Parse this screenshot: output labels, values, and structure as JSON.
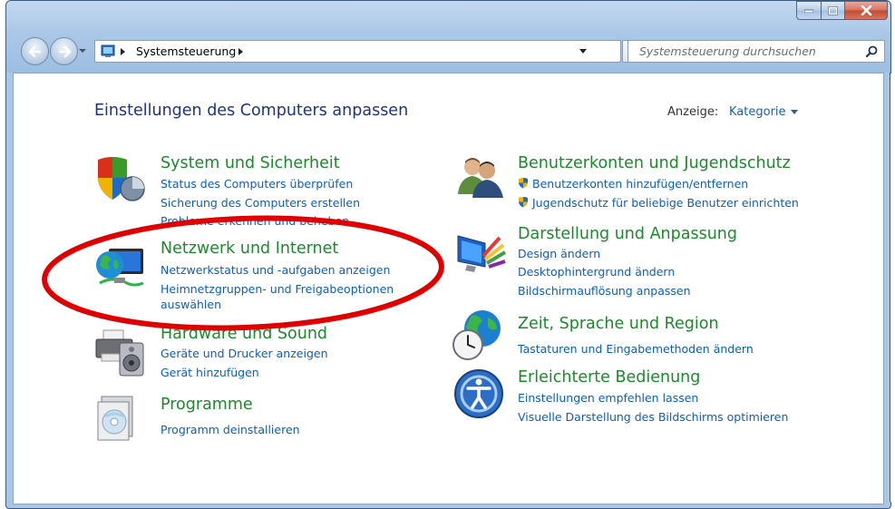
{
  "window": {
    "breadcrumb_root": "Systemsteuerung"
  },
  "search": {
    "placeholder": "Systemsteuerung durchsuchen"
  },
  "header": {
    "title": "Einstellungen des Computers anpassen",
    "view_label": "Anzeige:",
    "view_value": "Kategorie"
  },
  "categories": [
    {
      "title": "System und Sicherheit",
      "icon": "shield-icon",
      "links": [
        "Status des Computers überprüfen",
        "Sicherung des Computers erstellen",
        "Probleme erkennen und beheben"
      ]
    },
    {
      "title": "Netzwerk und Internet",
      "icon": "network-globe-icon",
      "links": [
        "Netzwerkstatus und -aufgaben anzeigen",
        "Heimnetzgruppen- und Freigabeoptionen",
        "auswählen"
      ]
    },
    {
      "title": "Hardware und Sound",
      "icon": "printer-speaker-icon",
      "links": [
        "Geräte und Drucker anzeigen",
        "Gerät hinzufügen"
      ]
    },
    {
      "title": "Programme",
      "icon": "programs-icon",
      "links": [
        "Programm deinstallieren"
      ]
    },
    {
      "title": "Benutzerkonten und Jugendschutz",
      "icon": "users-icon",
      "links": [
        "Benutzerkonten hinzufügen/entfernen",
        "Jugendschutz für beliebige Benutzer einrichten"
      ]
    },
    {
      "title": "Darstellung und Anpassung",
      "icon": "appearance-icon",
      "links": [
        "Design ändern",
        "Desktophintergrund ändern",
        "Bildschirmauflösung anpassen"
      ]
    },
    {
      "title": "Zeit, Sprache und Region",
      "icon": "clock-globe-icon",
      "links": [
        "Tastaturen und Eingabemethoden ändern"
      ]
    },
    {
      "title": "Erleichterte Bedienung",
      "icon": "accessibility-icon",
      "links": [
        "Einstellungen empfehlen lassen",
        "Visuelle Darstellung des Bildschirms optimieren"
      ]
    }
  ],
  "colors": {
    "category_title": "#1a8a2a",
    "link": "#0b5fbe",
    "page_title": "#1e3287",
    "annotation": "#e00000"
  }
}
